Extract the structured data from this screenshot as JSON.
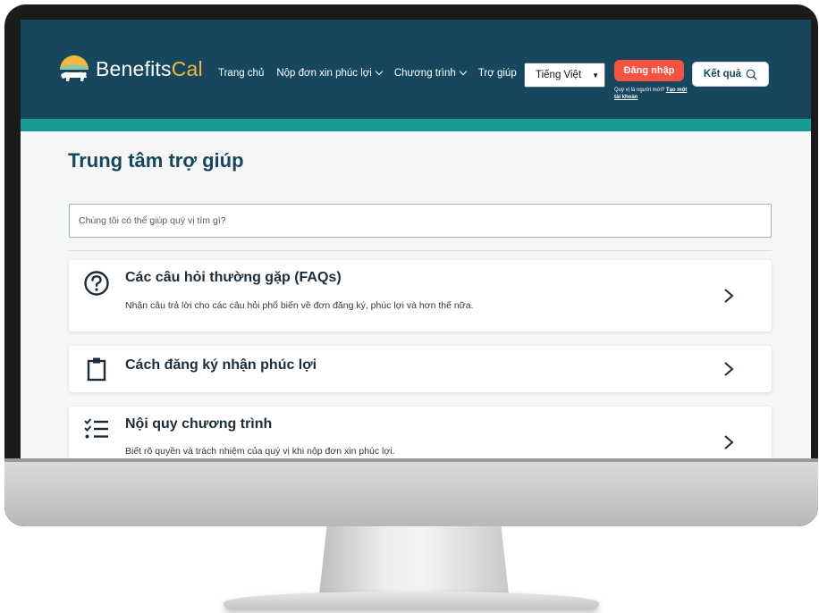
{
  "header": {
    "logo_text_main": "Benefits",
    "logo_text_accent": "Cal",
    "nav": [
      {
        "label": "Trang chủ"
      },
      {
        "label": "Nộp đơn xin phúc lợi"
      },
      {
        "label": "Chương trình"
      },
      {
        "label": "Trợ giúp"
      }
    ],
    "language_selected": "Tiếng Việt",
    "login_label": "Đăng nhập",
    "new_user_prompt": "Quý vị là người mới?",
    "create_account_link": "Tạo một tài khoản",
    "results_label": "Kết quả"
  },
  "main": {
    "title": "Trung tâm trợ giúp",
    "search_placeholder": "Chúng tôi có thể giúp quý vị tìm gì?",
    "cards": [
      {
        "title": "Các câu hỏi thường gặp (FAQs)",
        "description": "Nhận câu trả lời cho các câu hỏi phổ biến về đơn đăng ký, phúc lợi và hơn thế nữa."
      },
      {
        "title": "Cách đăng ký nhận phúc lợi",
        "description": ""
      },
      {
        "title": "Nội quy chương trình",
        "description": "Biết rõ quyền và trách nhiệm của quý vị khi nộp đơn xin phúc lợi."
      }
    ]
  },
  "colors": {
    "header_bg": "#17465f",
    "accent_teal": "#1a9a96",
    "login_red": "#f4533f",
    "logo_gold": "#f5b73b"
  },
  "icons": [
    "bear-sun-logo-icon",
    "chevron-down-icon",
    "search-icon",
    "question-circle-icon",
    "clipboard-icon",
    "checklist-icon",
    "chevron-right-icon"
  ]
}
